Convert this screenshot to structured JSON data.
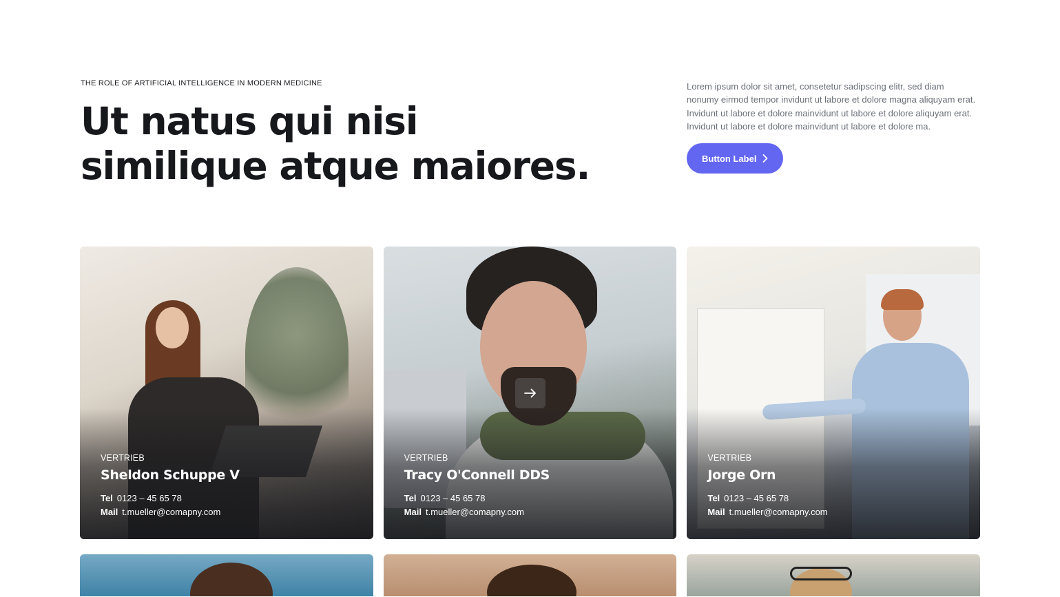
{
  "hero": {
    "eyebrow": "THE ROLE OF ARTIFICIAL INTELLIGENCE IN MODERN MEDICINE",
    "headline": "Ut natus qui nisi similique atque maiores.",
    "intro": "Lorem ipsum dolor sit amet, consetetur sadipscing elitr, sed diam nonumy eirmod tempor invidunt ut labore et dolore magna aliquyam erat. Invidunt ut labore et dolore mainvidunt ut labore et dolore aliquyam erat. Invidunt ut labore et dolore mainvidunt ut labore et dolore ma.",
    "button_label": "Button Label"
  },
  "team": [
    {
      "department": "VERTRIEB",
      "name": "Sheldon Schuppe V",
      "tel_label": "Tel",
      "tel": "0123 – 45 65 78",
      "mail_label": "Mail",
      "mail": "t.mueller@comapny.com"
    },
    {
      "department": "VERTRIEB",
      "name": "Tracy O'Connell DDS",
      "tel_label": "Tel",
      "tel": "0123 – 45 65 78",
      "mail_label": "Mail",
      "mail": "t.mueller@comapny.com"
    },
    {
      "department": "VERTRIEB",
      "name": "Jorge Orn",
      "tel_label": "Tel",
      "tel": "0123 – 45 65 78",
      "mail_label": "Mail",
      "mail": "t.mueller@comapny.com"
    }
  ],
  "icons": {
    "button": "chevron-right-icon",
    "card_hover": "arrow-right-icon"
  },
  "colors": {
    "accent": "#6366f1",
    "heading": "#17181c",
    "body_text": "#6b6f78"
  }
}
